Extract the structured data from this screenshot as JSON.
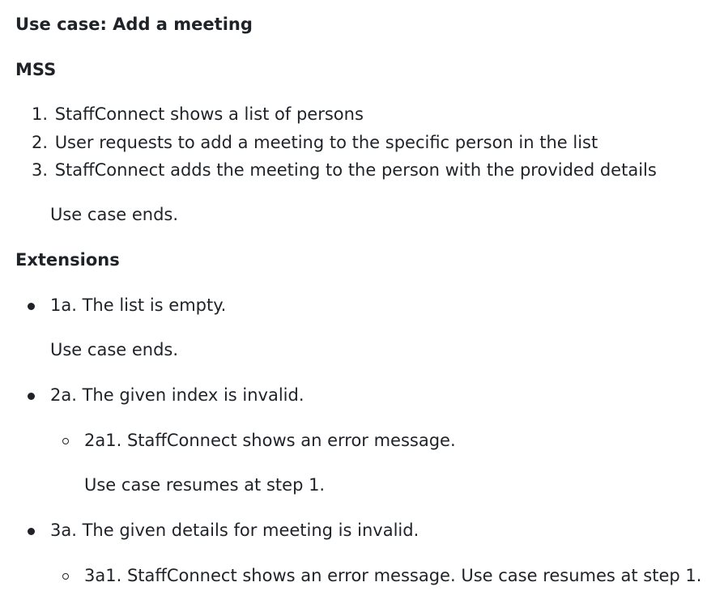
{
  "title": "Use case: Add a meeting",
  "mss_heading": "MSS",
  "mss_steps": [
    "StaffConnect shows a list of persons",
    "User requests to add a meeting to the specific person in the list",
    "StaffConnect adds the meeting to the person with the provided details"
  ],
  "mss_numbers": [
    "1.",
    "2.",
    "3."
  ],
  "mss_end": "Use case ends.",
  "extensions_heading": "Extensions",
  "extensions": {
    "e1": "1a. The list is empty.",
    "e1_end": "Use case ends.",
    "e2": "2a. The given index is invalid.",
    "e2_sub": "2a1. StaffConnect shows an error message.",
    "e2_sub_end": "Use case resumes at step 1.",
    "e3": "3a. The given details for meeting is invalid.",
    "e3_sub": "3a1. StaffConnect shows an error message. Use case resumes at step 1."
  }
}
